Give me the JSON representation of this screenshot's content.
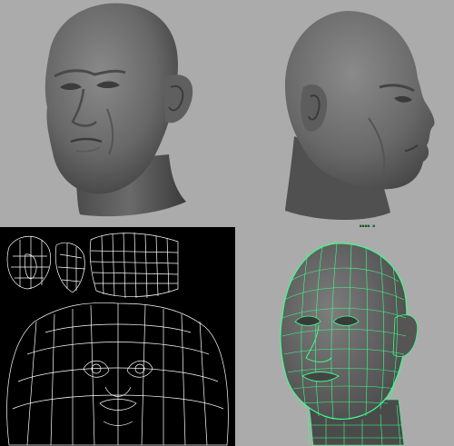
{
  "viewport": {
    "name": "maya-head-model-views",
    "panels": [
      {
        "id": "shaded-front-three-quarter",
        "mode": "smooth-shaded"
      },
      {
        "id": "shaded-side-profile",
        "mode": "smooth-shaded"
      },
      {
        "id": "uv-layout",
        "mode": "uv-wireframe"
      },
      {
        "id": "wireframe-on-shaded",
        "mode": "wireframe-on-shaded"
      }
    ]
  },
  "labels": {
    "tiny_tag": "■■■■ ■"
  },
  "colors": {
    "background": "#ababab",
    "uv_background": "#000000",
    "uv_lines": "#ffffff",
    "wire_highlight": "#3dff8a",
    "skin_shade": "#6e6e6e"
  }
}
